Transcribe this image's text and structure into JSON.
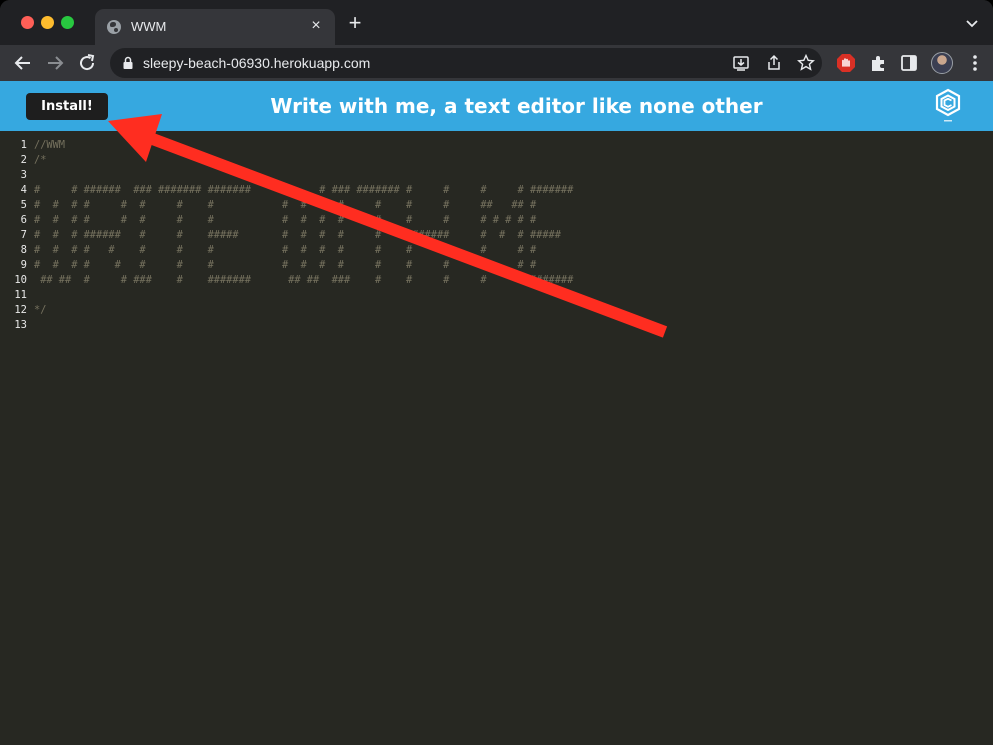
{
  "browser": {
    "tab": {
      "title": "WWM",
      "favicon": "globe-icon",
      "close": "×"
    },
    "new_tab": "+",
    "url": "sleepy-beach-06930.herokuapp.com"
  },
  "app": {
    "install_label": "Install!",
    "title": "Write with me, a text editor like none other",
    "header_color": "#36a8e0",
    "logo_icon": "hexagon-logo-icon"
  },
  "editor": {
    "line_numbers": [
      "1",
      "2",
      "3",
      "4",
      "5",
      "6",
      "7",
      "8",
      "9",
      "10",
      "11",
      "12",
      "13"
    ],
    "lines": [
      "//WWM",
      "/*",
      "",
      "#     # ######  ### ####### #######     #     # ### ####### #     #     #     # #######",
      "#  #  # #     #  #     #    #           #  #  #  #     #    #     #     ##   ## #",
      "#  #  # #     #  #     #    #           #  #  #  #     #    #     #     # # # # #",
      "#  #  # ######   #     #    #####       #  #  #  #     #    #######     #  #  # #####",
      "#  #  # #   #    #     #    #           #  #  #  #     #    #     #     #     # #",
      "#  #  # #    #   #     #    #           #  #  #  #     #    #     #     #     # #",
      " ## ##  #     # ###    #    #######      ## ##  ###    #    #     #     #     # #######",
      "",
      "*/",
      ""
    ]
  }
}
